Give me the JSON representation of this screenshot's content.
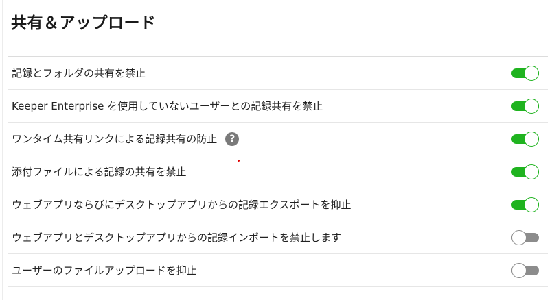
{
  "title": "共有＆アップロード",
  "settings": [
    {
      "label": "記録とフォルダの共有を禁止",
      "enabled": true,
      "help": false
    },
    {
      "label": "Keeper Enterprise を使用していないユーザーとの記録共有を禁止",
      "enabled": true,
      "help": false
    },
    {
      "label": "ワンタイム共有リンクによる記録共有の防止",
      "enabled": true,
      "help": true
    },
    {
      "label": "添付ファイルによる記録の共有を禁止",
      "enabled": true,
      "help": false
    },
    {
      "label": "ウェブアプリならびにデスクトップアプリからの記録エクスポートを抑止",
      "enabled": true,
      "help": false
    },
    {
      "label": "ウェブアプリとデスクトップアプリからの記録インポートを禁止します",
      "enabled": false,
      "help": false
    },
    {
      "label": "ユーザーのファイルアップロードを抑止",
      "enabled": false,
      "help": false
    }
  ],
  "help_glyph": "?",
  "icons": {
    "help": "question-circle-icon"
  },
  "colors": {
    "toggle_on": "#1fb31f",
    "toggle_off": "#8c8c8c",
    "help_icon": "#7a7a7a"
  }
}
